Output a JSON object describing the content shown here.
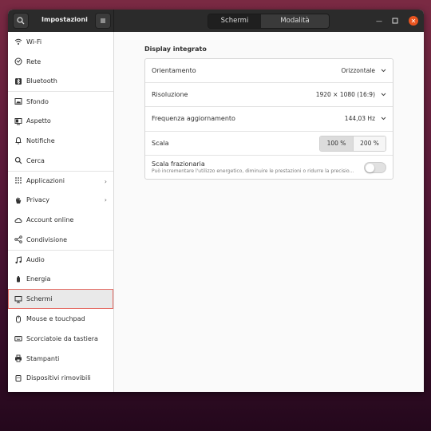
{
  "header": {
    "title": "Impostazioni",
    "tabs": [
      "Schermi",
      "Modalità notturna"
    ]
  },
  "sidebar": {
    "items": [
      {
        "label": "Wi-Fi",
        "icon": "wifi-icon"
      },
      {
        "label": "Rete",
        "icon": "network-icon"
      },
      {
        "label": "Bluetooth",
        "icon": "bluetooth-icon"
      },
      {
        "label": "Sfondo",
        "icon": "background-icon"
      },
      {
        "label": "Aspetto",
        "icon": "appearance-icon"
      },
      {
        "label": "Notifiche",
        "icon": "bell-icon"
      },
      {
        "label": "Cerca",
        "icon": "search-icon"
      },
      {
        "label": "Applicazioni",
        "icon": "apps-grid-icon",
        "chevron": true
      },
      {
        "label": "Privacy",
        "icon": "hand-icon",
        "chevron": true
      },
      {
        "label": "Account online",
        "icon": "cloud-icon"
      },
      {
        "label": "Condivisione",
        "icon": "share-icon"
      },
      {
        "label": "Audio",
        "icon": "music-note-icon"
      },
      {
        "label": "Energia",
        "icon": "power-icon"
      },
      {
        "label": "Schermi",
        "icon": "display-icon",
        "active": true
      },
      {
        "label": "Mouse e touchpad",
        "icon": "mouse-icon"
      },
      {
        "label": "Scorciatoie da tastiera",
        "icon": "keyboard-icon"
      },
      {
        "label": "Stampanti",
        "icon": "printer-icon"
      },
      {
        "label": "Dispositivi rimovibili",
        "icon": "usb-icon"
      }
    ]
  },
  "main": {
    "section_title": "Display integrato",
    "orientation": {
      "label": "Orientamento",
      "value": "Orizzontale"
    },
    "resolution": {
      "label": "Risoluzione",
      "value": "1920 × 1080 (16:9)"
    },
    "refresh": {
      "label": "Frequenza aggiornamento",
      "value": "144,03 Hz"
    },
    "scale": {
      "label": "Scala",
      "options": [
        "100 %",
        "200 %"
      ],
      "selected": "100 %"
    },
    "fractional": {
      "label": "Scala frazionaria",
      "description": "Può incrementare l'utilizzo energetico, diminuire le prestazioni o ridurre la precisio…",
      "enabled": false
    }
  },
  "colors": {
    "accent": "#e9541f",
    "active_outline": "#e46d66"
  }
}
